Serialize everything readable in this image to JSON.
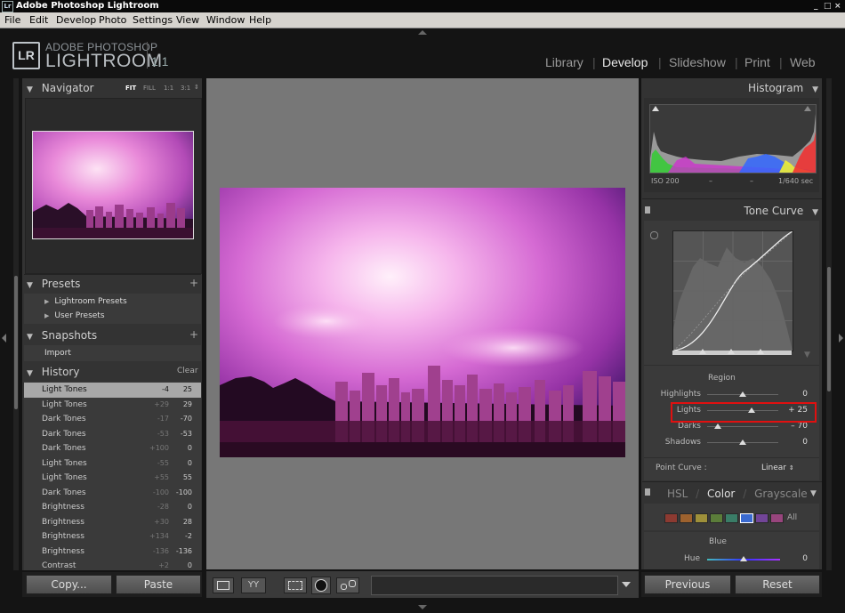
{
  "window": {
    "title": "Adobe Photoshop Lightroom",
    "controls": [
      "_",
      "□",
      "×"
    ]
  },
  "menu": [
    "File",
    "Edit",
    "Develop",
    "Photo",
    "Settings",
    "View",
    "Window",
    "Help"
  ],
  "branding": {
    "lr": "LR",
    "adobe": "ADOBE PHOTOSHOP",
    "name": "LIGHTROOM",
    "version": "1.1"
  },
  "modules": [
    {
      "label": "Library",
      "active": false
    },
    {
      "label": "Develop",
      "active": true
    },
    {
      "label": "Slideshow",
      "active": false
    },
    {
      "label": "Print",
      "active": false
    },
    {
      "label": "Web",
      "active": false
    }
  ],
  "navigator": {
    "title": "Navigator",
    "zoom": [
      "FIT",
      "FILL",
      "1:1",
      "3:1"
    ]
  },
  "presets": {
    "title": "Presets",
    "items": [
      "Lightroom Presets",
      "User Presets"
    ]
  },
  "snapshots": {
    "title": "Snapshots",
    "items": [
      "Import"
    ]
  },
  "history": {
    "title": "History",
    "clear": "Clear",
    "items": [
      {
        "name": "Light Tones",
        "delta": "-4",
        "value": "25",
        "selected": true
      },
      {
        "name": "Light Tones",
        "delta": "+29",
        "value": "29"
      },
      {
        "name": "Dark Tones",
        "delta": "-17",
        "value": "-70"
      },
      {
        "name": "Dark Tones",
        "delta": "-53",
        "value": "-53"
      },
      {
        "name": "Dark Tones",
        "delta": "+100",
        "value": "0"
      },
      {
        "name": "Light Tones",
        "delta": "-55",
        "value": "0"
      },
      {
        "name": "Light Tones",
        "delta": "+55",
        "value": "55"
      },
      {
        "name": "Dark Tones",
        "delta": "-100",
        "value": "-100"
      },
      {
        "name": "Brightness",
        "delta": "-28",
        "value": "0"
      },
      {
        "name": "Brightness",
        "delta": "+30",
        "value": "28"
      },
      {
        "name": "Brightness",
        "delta": "+134",
        "value": "-2"
      },
      {
        "name": "Brightness",
        "delta": "-136",
        "value": "-136"
      },
      {
        "name": "Contrast",
        "delta": "+2",
        "value": "0"
      }
    ]
  },
  "left_buttons": {
    "copy": "Copy...",
    "paste": "Paste"
  },
  "histogram": {
    "title": "Histogram",
    "iso": "ISO 200",
    "dash1": "–",
    "dash2": "–",
    "shutter": "1/640 sec"
  },
  "tone_curve": {
    "title": "Tone Curve",
    "region_label": "Region",
    "sliders": [
      {
        "label": "Highlights",
        "value": "0",
        "pos": 0.5
      },
      {
        "label": "Lights",
        "value": "+ 25",
        "pos": 0.625,
        "highlighted": true
      },
      {
        "label": "Darks",
        "value": "– 70",
        "pos": 0.15
      },
      {
        "label": "Shadows",
        "value": "0",
        "pos": 0.5
      }
    ],
    "point_curve_label": "Point Curve :",
    "point_curve_value": "Linear"
  },
  "hsl": {
    "tabs": [
      "HSL",
      "Color",
      "Grayscale"
    ],
    "separator": "/",
    "all": "All",
    "section": "Blue",
    "slider": {
      "label": "Hue",
      "value": "0",
      "pos": 0.5
    },
    "swatches": [
      "#b03a2e",
      "#c8732a",
      "#c9b53a",
      "#6a9a3a",
      "#3a9a7a",
      "#3a6ad0",
      "#8a4ac0",
      "#c04a9a"
    ]
  },
  "right_buttons": {
    "previous": "Previous",
    "reset": "Reset"
  },
  "accent": "#e01010"
}
